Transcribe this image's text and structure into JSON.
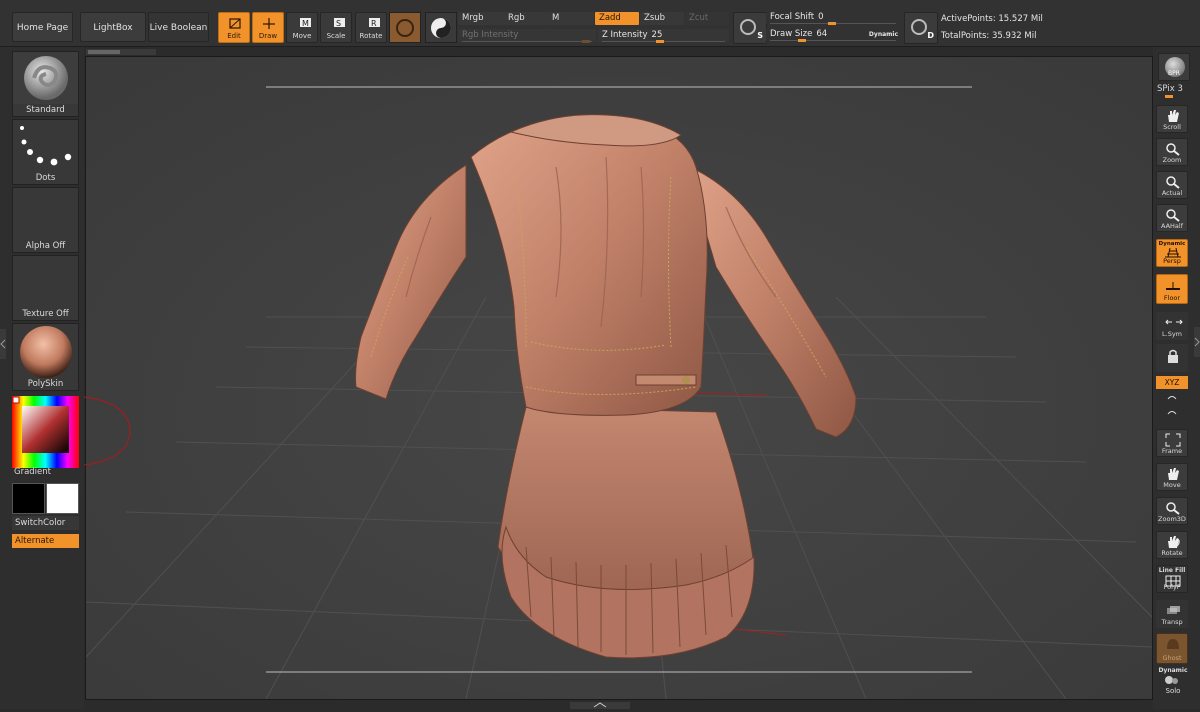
{
  "nav": {
    "home_page": "Home Page",
    "lightbox": "LightBox",
    "live_boolean": "Live Boolean"
  },
  "tools": {
    "edit": "Edit",
    "draw": "Draw",
    "move": "Move",
    "scale": "Scale",
    "rotate": "Rotate"
  },
  "channels": {
    "mrgb": "Mrgb",
    "rgb": "Rgb",
    "m": "M",
    "zadd": "Zadd",
    "zsub": "Zsub",
    "zcut": "Zcut"
  },
  "sliders": {
    "rgb_intensity_label": "Rgb Intensity",
    "z_intensity_label": "Z Intensity",
    "z_intensity_value": "25",
    "focal_shift_label": "Focal Shift",
    "focal_shift_value": "0",
    "draw_size_label": "Draw Size",
    "draw_size_value": "64",
    "dynamic_label": "Dynamic"
  },
  "points": {
    "active": "ActivePoints: 15.527 Mil",
    "total": "TotalPoints: 35.932 Mil"
  },
  "left": {
    "brush": "Standard",
    "stroke": "Dots",
    "alpha": "Alpha Off",
    "texture": "Texture Off",
    "material": "PolySkin",
    "gradient": "Gradient",
    "switch_color": "SwitchColor",
    "alternate": "Alternate"
  },
  "right": {
    "bpr": "BPR",
    "spix_label": "SPix",
    "spix_value": "3",
    "scroll": "Scroll",
    "zoom": "Zoom",
    "actual": "Actual",
    "aahalf": "AAHalf",
    "dynamic_top": "Dynamic",
    "persp": "Persp",
    "floor": "Floor",
    "lsym": "L.Sym",
    "xyz": "XYZ",
    "frame": "Frame",
    "move": "Move",
    "zoom3d": "Zoom3D",
    "rotate": "Rotate",
    "line_fill": "Line Fill",
    "polyf": "PolyF",
    "transp": "Transp",
    "ghost": "Ghost",
    "dynamic_bottom": "Dynamic",
    "solo": "Solo"
  },
  "colors": {
    "accent": "#f2922a",
    "primary_color": "#000000",
    "secondary_color": "#ffffff",
    "model": "#c98a72"
  }
}
